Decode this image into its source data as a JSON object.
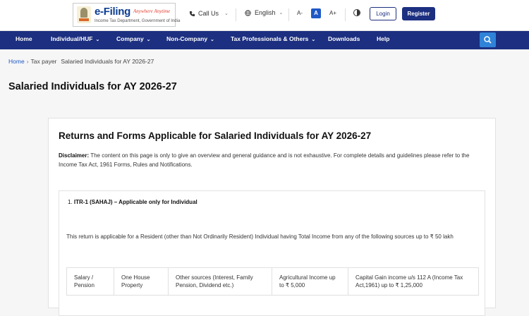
{
  "header": {
    "logo": {
      "brand": "e-Filing",
      "tagline": "Anywhere Anytime",
      "subtitle": "Income Tax Department, Government of India"
    },
    "call_label": "Call Us",
    "language": "English",
    "font_sizes": [
      "A-",
      "A",
      "A+"
    ],
    "login_label": "Login",
    "register_label": "Register"
  },
  "nav": {
    "items": [
      {
        "label": "Home",
        "has_dropdown": false
      },
      {
        "label": "Individual/HUF",
        "has_dropdown": true
      },
      {
        "label": "Company",
        "has_dropdown": true
      },
      {
        "label": "Non-Company",
        "has_dropdown": true
      },
      {
        "label": "Tax Professionals & Others",
        "has_dropdown": true
      },
      {
        "label": "Downloads",
        "has_dropdown": false
      },
      {
        "label": "Help",
        "has_dropdown": false
      }
    ]
  },
  "breadcrumb": {
    "home": "Home",
    "section": "Tax payer",
    "current": "Salaried Individuals for AY 2026-27"
  },
  "page_title": "Salaried Individuals for AY 2026-27",
  "content": {
    "heading": "Returns and Forms Applicable for Salaried Individuals for AY 2026-27",
    "disclaimer_label": "Disclaimer:",
    "disclaimer_text": "The content on this page is only to give an overview and general guidance and is not exhaustive. For complete details and guidelines please refer to the Income Tax Act, 1961 Forms, Rules and Notifications.",
    "itr1": {
      "number": "1.",
      "title": "ITR-1 (SAHAJ) – Applicable only for Individual",
      "description": "This return is applicable for a Resident (other than Not Ordinarily Resident) Individual having Total Income from any of the following sources up to ₹ 50 lakh",
      "sources": [
        "Salary / Pension",
        "One House Property",
        "Other sources (Interest, Family Pension, Dividend etc.)",
        "Agricultural Income up to ₹ 5,000",
        "Capital Gain income u/s 112 A (Income Tax Act,1961) up to ₹ 1,25,000"
      ]
    }
  },
  "colors": {
    "nav_bg": "#1c2f80",
    "link": "#1f58c7",
    "search_button": "#2f83d8"
  }
}
